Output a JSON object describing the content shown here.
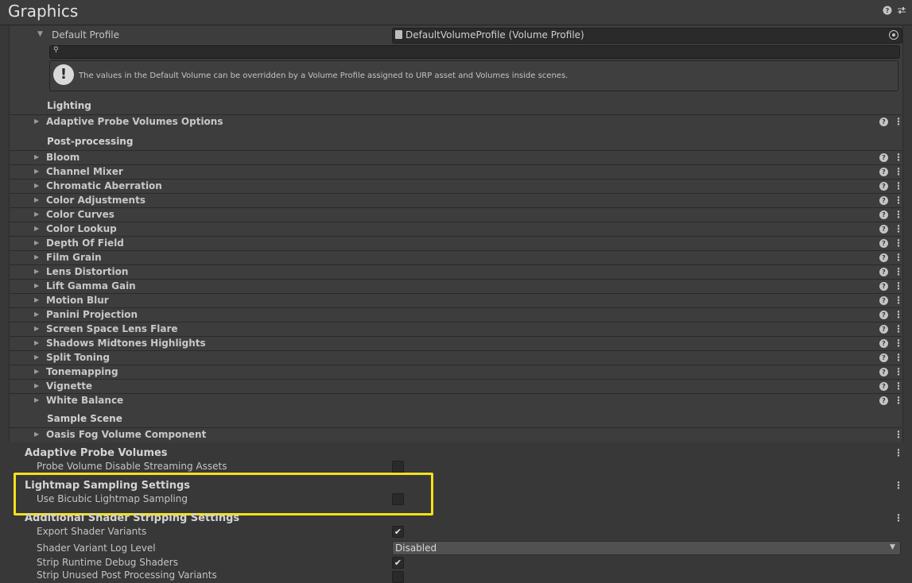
{
  "header": {
    "title": "Graphics",
    "help_icon": "help-icon",
    "settings_icon": "sliders-icon"
  },
  "default_profile": {
    "label": "Default Profile",
    "value": "DefaultVolumeProfile (Volume Profile)",
    "help_text": "The values in the Default Volume can be overridden by a Volume Profile assigned to URP asset and Volumes inside scenes."
  },
  "groups": {
    "lighting": "Lighting",
    "post_processing": "Post-processing",
    "sample_scene": "Sample Scene"
  },
  "lighting_items": [
    "Adaptive Probe Volumes Options"
  ],
  "post_items": [
    "Bloom",
    "Channel Mixer",
    "Chromatic Aberration",
    "Color Adjustments",
    "Color Curves",
    "Color Lookup",
    "Depth Of Field",
    "Film Grain",
    "Lens Distortion",
    "Lift Gamma Gain",
    "Motion Blur",
    "Panini Projection",
    "Screen Space Lens Flare",
    "Shadows Midtones Highlights",
    "Split Toning",
    "Tonemapping",
    "Vignette",
    "White Balance"
  ],
  "scene_items": [
    "Oasis Fog Volume Component"
  ],
  "apv": {
    "title": "Adaptive Probe Volumes",
    "disable_streaming_label": "Probe Volume Disable Streaming Assets",
    "disable_streaming_checked": false
  },
  "lightmap": {
    "title": "Lightmap Sampling Settings",
    "bicubic_label": "Use Bicubic Lightmap Sampling",
    "bicubic_checked": false
  },
  "stripping": {
    "title": "Additional Shader Stripping Settings",
    "export_label": "Export Shader Variants",
    "export_checked": true,
    "log_level_label": "Shader Variant Log Level",
    "log_level_value": "Disabled",
    "strip_debug_label": "Strip Runtime Debug Shaders",
    "strip_debug_checked": true,
    "strip_unused_label": "Strip Unused Post Processing Variants"
  },
  "colors": {
    "highlight": "#f4e11a",
    "background": "#383838"
  }
}
